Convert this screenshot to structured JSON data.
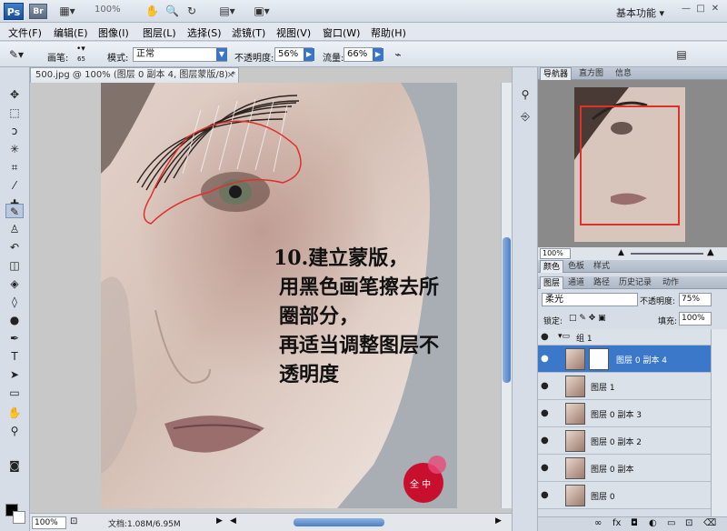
{
  "appbar": {
    "ps": "Ps",
    "br": "Br",
    "zoom": "100%",
    "workspace": "基本功能",
    "min": "—",
    "max": "□",
    "close": "✕"
  },
  "menu": [
    "文件(F)",
    "编辑(E)",
    "图像(I)",
    "图层(L)",
    "选择(S)",
    "滤镜(T)",
    "视图(V)",
    "窗口(W)",
    "帮助(H)"
  ],
  "options": {
    "brush_label": "画笔:",
    "brush_size": "65",
    "mode_label": "模式:",
    "mode": "正常",
    "opacity_label": "不透明度:",
    "opacity": "56%",
    "flow_label": "流量:",
    "flow": "66%"
  },
  "document": {
    "tab": "500.jpg @ 100% (图层 0 副本 4, 图层蒙版/8) *",
    "close": "×",
    "annotation": [
      "10.建立蒙版，",
      "用黑色画笔擦去所",
      "圈部分，",
      "再适当调整图层不",
      "透明度"
    ],
    "watermark": "全 中"
  },
  "status": {
    "zoom": "100%",
    "doc": "文档:1.08M/6.95M"
  },
  "navigator": {
    "tabs": [
      "导航器",
      "直方图",
      "信息"
    ],
    "zoom": "100%"
  },
  "color_panel": {
    "tabs": [
      "颜色",
      "色板",
      "样式"
    ]
  },
  "layers_panel": {
    "tabs": [
      "图层",
      "通道",
      "路径",
      "历史记录",
      "动作"
    ],
    "blend": "柔光",
    "opacity_label": "不透明度:",
    "opacity": "75%",
    "lock_label": "锁定:",
    "fill_label": "填充:",
    "fill": "100%",
    "group": "组 1",
    "layers": [
      {
        "name": "图层 0 副本 4",
        "selected": true
      },
      {
        "name": "图层 1",
        "selected": false
      },
      {
        "name": "图层 0 副本 3",
        "selected": false
      },
      {
        "name": "图层 0 副本 2",
        "selected": false
      },
      {
        "name": "图层 0 副本",
        "selected": false
      },
      {
        "name": "图层 0",
        "selected": false
      }
    ]
  },
  "colors": {
    "accent": "#3b78c9",
    "annotation": "#e0302c",
    "foreground": "#000000",
    "background": "#ffffff"
  }
}
